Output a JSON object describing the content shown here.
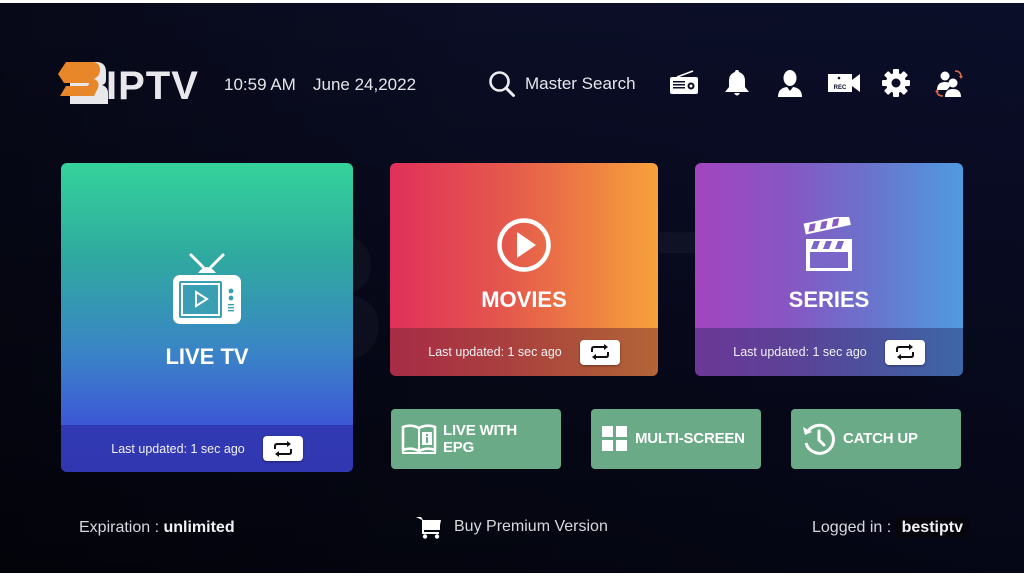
{
  "header": {
    "logo_text": "IPTV",
    "logo_brand_color": "#e8872a",
    "time": "10:59 AM",
    "date": "June 24,2022",
    "search_label": "Master Search",
    "icons": [
      "radio-icon",
      "bell-icon",
      "user-icon",
      "record-camera-icon",
      "gear-icon",
      "switch-user-icon"
    ],
    "rec_label": "REC"
  },
  "watermark": "BIPTV",
  "cards": {
    "live_tv": {
      "title": "LIVE TV",
      "updated": "Last updated: 1 sec ago"
    },
    "movies": {
      "title": "MOVIES",
      "updated": "Last updated: 1 sec ago"
    },
    "series": {
      "title": "SERIES",
      "updated": "Last updated: 1 sec ago"
    }
  },
  "quick_buttons": {
    "epg": {
      "line1": "LIVE WITH",
      "line2": "EPG"
    },
    "multiscreen": {
      "label": "MULTI-SCREEN"
    },
    "catchup": {
      "label": "CATCH UP"
    },
    "color": "#6aaa86"
  },
  "footer": {
    "expiration_label": "Expiration : ",
    "expiration_value": "unlimited",
    "buy_label": "Buy Premium Version",
    "logged_label": "Logged in : ",
    "logged_value": "bestiptv"
  }
}
